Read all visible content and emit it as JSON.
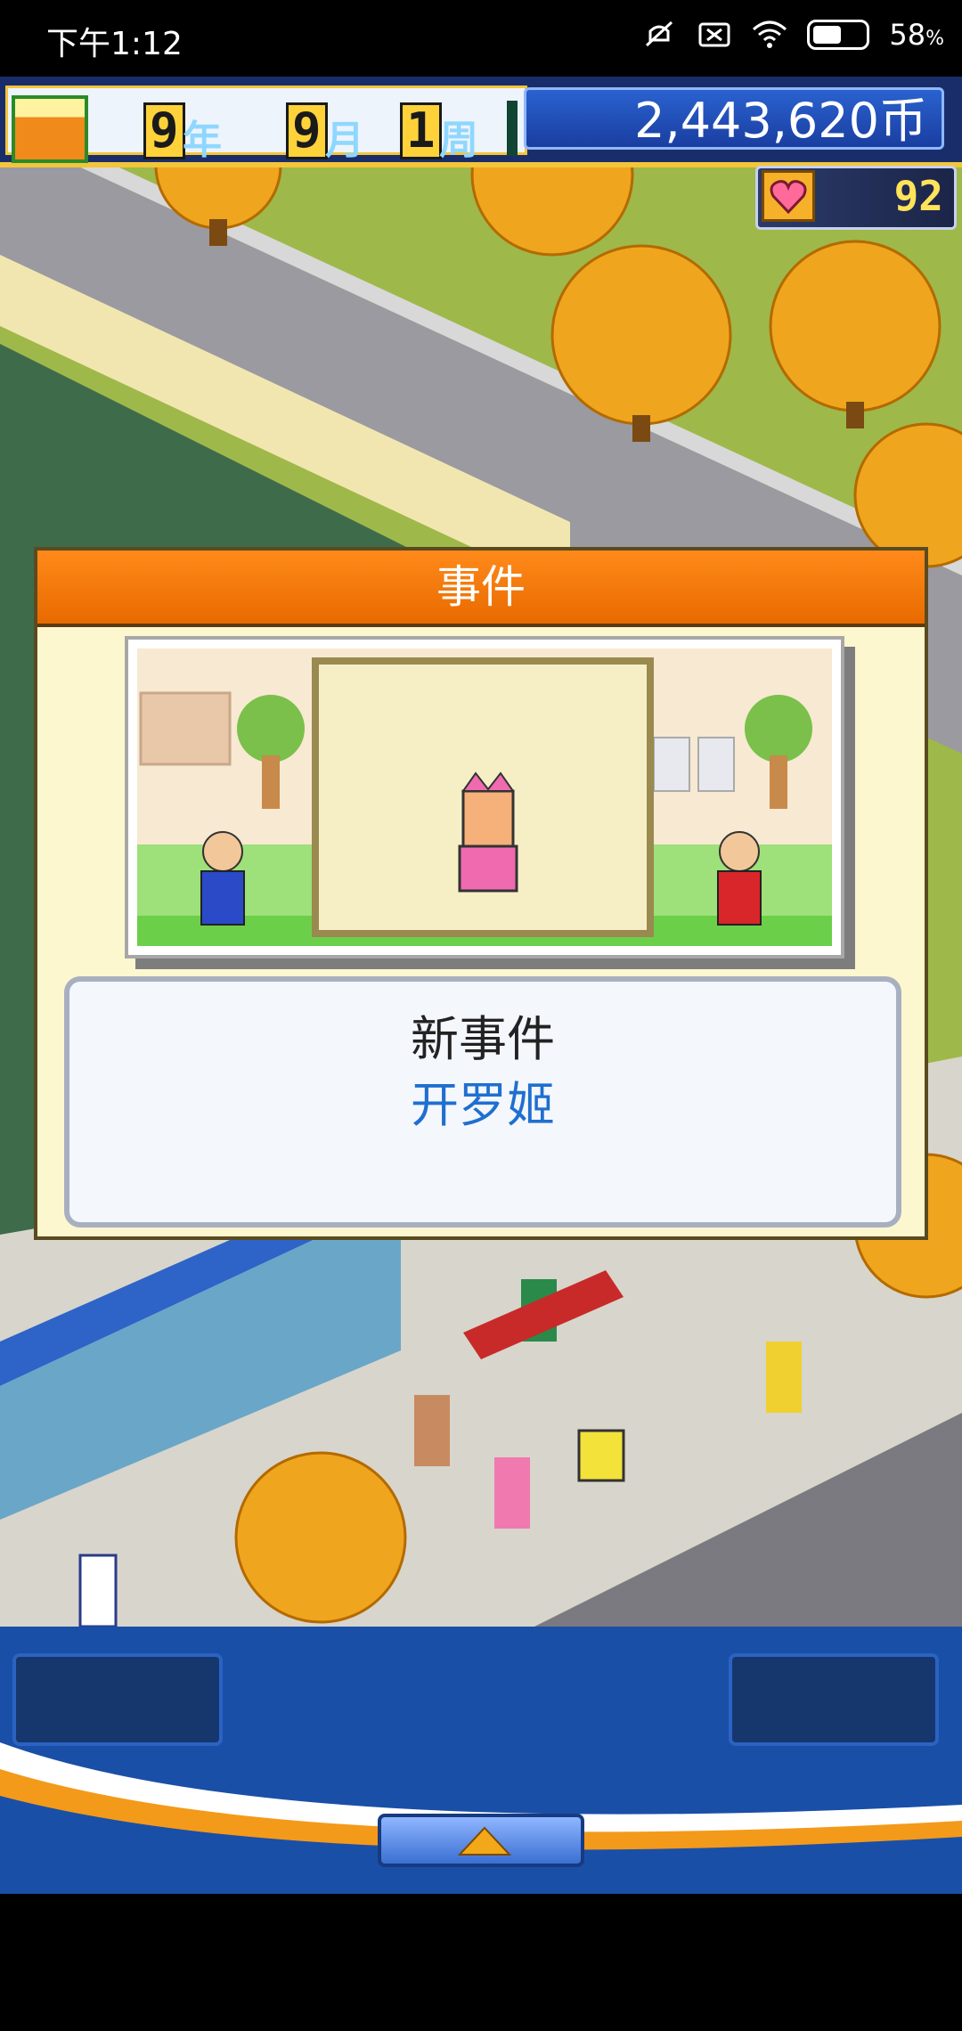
{
  "status_bar": {
    "time": "下午1:12",
    "battery_percent_text": "58",
    "battery_unit": "%",
    "battery_level": 0.58,
    "icons": [
      "mute-icon",
      "close-box-icon",
      "wifi-icon",
      "battery-icon"
    ]
  },
  "hud": {
    "year_value": "9",
    "year_unit": "年",
    "month_value": "9",
    "month_unit": "月",
    "week_value": "1",
    "week_unit": "周",
    "money": "2,443,620币",
    "popularity": "92"
  },
  "event": {
    "title": "事件",
    "subtitle": "新事件",
    "name": "开罗姬"
  },
  "colors": {
    "title_orange": "#ff8a1a",
    "event_name_blue": "#1f6fd0",
    "panel_blue": "#1a4fa8",
    "money_gold": "#f3c53a"
  }
}
